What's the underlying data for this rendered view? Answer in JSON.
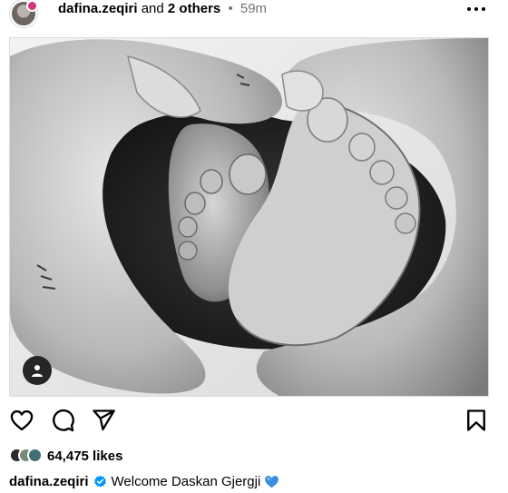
{
  "post": {
    "author": {
      "username": "dafina.zeqiri",
      "conjunction": "and",
      "others": "2 others",
      "separator": "•",
      "time": "59m"
    },
    "photo": {
      "style": "black-and-white",
      "subject": "parents' hands forming a heart around a baby's feet"
    },
    "likes_text": "64,475 likes",
    "caption": {
      "username": "dafina.zeqiri",
      "text": "Welcome Daskan Gjergji"
    }
  },
  "icons": {
    "more": "more-horizontal-icon",
    "like": "heart-outline-icon",
    "comment": "comment-icon",
    "share": "send-icon",
    "save": "bookmark-icon",
    "tag": "user-tag-icon",
    "verified": "verified-badge-icon",
    "emoji": "blue-heart-emoji"
  },
  "colors": {
    "text_primary": "#000000",
    "text_secondary": "#737373",
    "verified_blue": "#0095f6",
    "emoji_blue": "#3c8ede"
  }
}
